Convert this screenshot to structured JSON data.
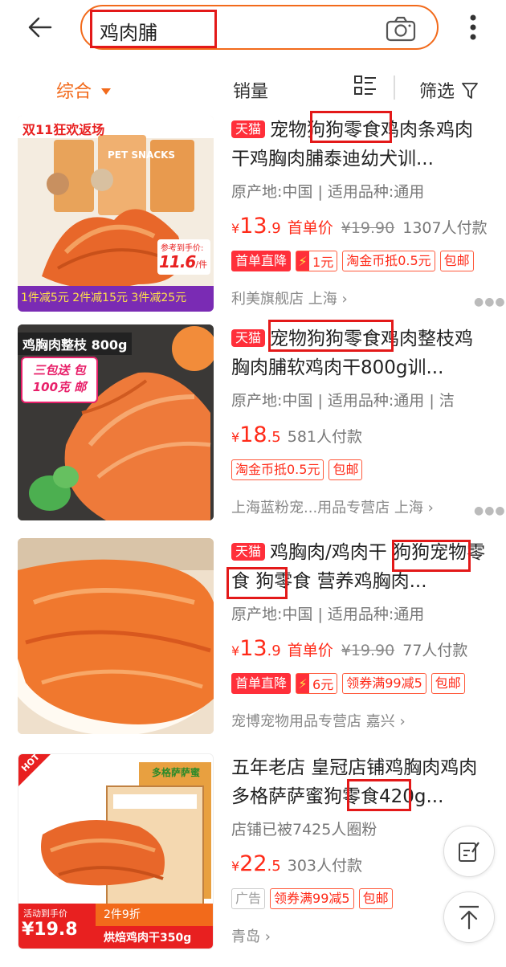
{
  "search": {
    "query": "鸡肉脯"
  },
  "sort": {
    "items": [
      "综合",
      "销量",
      "筛选"
    ]
  },
  "products": [
    {
      "tmall": "天猫",
      "title": "宠物狗狗零食鸡肉条鸡肉干鸡胸肉脯泰迪幼犬训...",
      "attr": "原产地:中国 | 适用品种:通用",
      "price_int": "13",
      "price_dec": ".9",
      "price_label": "首单价",
      "orig": "¥19.90",
      "paid": "1307人付款",
      "tags": {
        "first": "首单直降",
        "amount": "1元",
        "coin": "淘金币抵0.5元",
        "ship": "包邮"
      },
      "shop": "利美旗舰店 上海 ›",
      "thumb": {
        "banner": "双11狂欢返场",
        "brand": "PET SNACKS",
        "hint": "参考到手价:",
        "price": "11.6",
        "unit": "/件",
        "promo": "1件减5元 2件减15元 3件减25元"
      }
    },
    {
      "tmall": "天猫",
      "title": "宠物狗狗零食鸡肉整枝鸡胸肉脯软鸡肉干800g训...",
      "attr": "原产地:中国 | 适用品种:通用 | 洁",
      "price_int": "18",
      "price_dec": ".5",
      "paid": "581人付款",
      "tags": {
        "coin": "淘金币抵0.5元",
        "ship": "包邮"
      },
      "shop": "上海蓝粉宠...用品专营店 上海 ›",
      "thumb": {
        "banner": "鸡胸肉整枝 800g",
        "badge_line1": "三包送 包",
        "badge_line2": "100克 邮"
      }
    },
    {
      "tmall": "天猫",
      "title": "鸡胸肉/鸡肉干 狗狗宠物零食 狗零食 营养鸡胸肉...",
      "attr": "原产地:中国 | 适用品种:通用",
      "price_int": "13",
      "price_dec": ".9",
      "price_label": "首单价",
      "orig": "¥19.90",
      "paid": "77人付款",
      "tags": {
        "first": "首单直降",
        "amount": "6元",
        "coupon": "领券满99减5",
        "ship": "包邮"
      },
      "shop": "宠博宠物用品专营店 嘉兴 ›"
    },
    {
      "title": "五年老店 皇冠店铺鸡胸肉鸡肉多格萨萨蜜狗零食420g...",
      "attr": "店铺已被7425人圈粉",
      "price_int": "22",
      "price_dec": ".5",
      "paid": "303人付款",
      "tags": {
        "ad": "广告",
        "coupon": "领券满99减5",
        "ship": "包邮"
      },
      "shop": "青岛 ›",
      "thumb": {
        "hot": "HOT",
        "brand": "多格萨萨蜜",
        "event_label": "活动到手价",
        "event_price": "¥19.8",
        "deal": "2件9折",
        "product": "烘焙鸡肉干350g"
      }
    }
  ],
  "colors": {
    "accent": "#f26a1b",
    "price": "#ff2a18",
    "highlight": "#e31919",
    "tmall": "#ff2f3a"
  }
}
